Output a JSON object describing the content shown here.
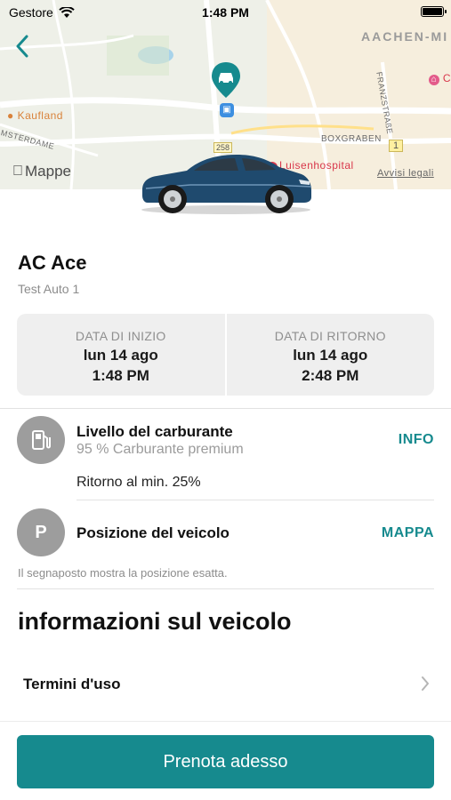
{
  "status_bar": {
    "carrier": "Gestore",
    "time": "1:48 PM"
  },
  "map": {
    "labels": {
      "city": "AACHEN-MI",
      "kaufland": "Kaufland",
      "boxgraben": "BOXGRABEN",
      "franzstrasse": "FRANZSTRAßE",
      "amsterdamer": "MSTERDAME",
      "road_258": "258",
      "road_1": "1",
      "hospital": "Luisenhospital",
      "top_right_poi": "C",
      "legal": "Avvisi legali",
      "apple_maps": "Mappe"
    }
  },
  "vehicle": {
    "name": "AC Ace",
    "subtitle": "Test Auto 1"
  },
  "dates": {
    "start_label": "DATA DI INIZIO",
    "start_day": "lun 14 ago",
    "start_time": "1:48 PM",
    "return_label": "DATA DI RITORNO",
    "return_day": "lun 14 ago",
    "return_time": "2:48 PM"
  },
  "fuel": {
    "title": "Livello del carburante",
    "subtitle": "95 % Carburante premium",
    "action": "INFO",
    "return_note": "Ritorno al min. 25%"
  },
  "position": {
    "icon_letter": "P",
    "title": "Posizione del veicolo",
    "action": "MAPPA",
    "note": "Il segnaposto mostra la posizione esatta."
  },
  "info_section": {
    "title": "informazioni sul veicolo",
    "terms_label": "Termini d'uso"
  },
  "book_button": {
    "label": "Prenota adesso"
  },
  "colors": {
    "accent": "#168a8e",
    "circle_gray": "#9d9d9d",
    "date_box": "#efefef"
  }
}
